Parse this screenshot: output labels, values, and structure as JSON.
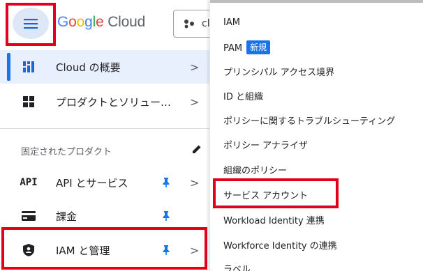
{
  "header": {
    "logo_google": "Google",
    "logo_cloud": "Cloud",
    "project_text": "cl"
  },
  "nav": {
    "items": [
      {
        "label": "Cloud の概要",
        "icon": "dashboard-icon"
      },
      {
        "label": "プロダクトとソリュー…",
        "icon": "grid-icon"
      },
      {
        "label": "API とサービス",
        "icon": "api-icon"
      },
      {
        "label": "課金",
        "icon": "billing-icon"
      },
      {
        "label": "IAM と管理",
        "icon": "shield-icon"
      }
    ],
    "pinned_section_title": "固定されたプロダクト",
    "api_icon_text": "API",
    "chevron": ">"
  },
  "submenu": {
    "items": [
      {
        "label": "IAM"
      },
      {
        "label": "PAM",
        "badge": "新規"
      },
      {
        "label": "プリンシパル アクセス境界"
      },
      {
        "label": "ID と組織"
      },
      {
        "label": "ポリシーに関するトラブルシューティング"
      },
      {
        "label": "ポリシー アナライザ"
      },
      {
        "label": "組織のポリシー"
      },
      {
        "label": "サービス アカウント"
      },
      {
        "label": "Workload Identity 連携"
      },
      {
        "label": "Workforce Identity の連携"
      },
      {
        "label": "ラベル"
      }
    ]
  },
  "colors": {
    "highlight": "#e3001b",
    "accent": "#1a73e8",
    "pin": "#1a73e8"
  }
}
